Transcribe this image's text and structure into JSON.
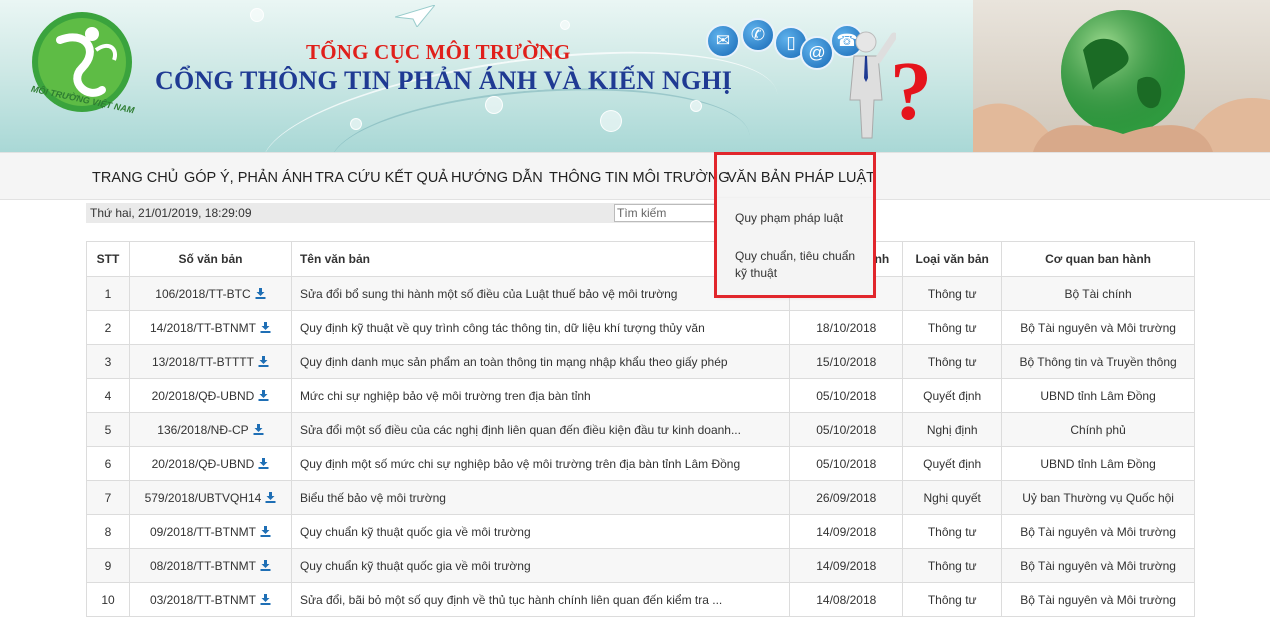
{
  "header": {
    "org_name": "TỔNG CỤC MÔI TRƯỜNG",
    "portal_name": "CỔNG THÔNG TIN PHẢN ÁNH VÀ KIẾN NGHỊ",
    "logo_text": "MÔI TRƯỜNG VIỆT NAM"
  },
  "nav": {
    "items": [
      {
        "label": "TRANG CHỦ"
      },
      {
        "label": "GÓP Ý, PHẢN ÁNH"
      },
      {
        "label": "TRA CỨU KẾT QUẢ"
      },
      {
        "label": "HƯỚNG DẪN"
      },
      {
        "label": "THÔNG TIN MÔI TRƯỜNG"
      },
      {
        "label": "VĂN BẢN PHÁP LUẬT"
      }
    ],
    "dropdown": [
      {
        "label": "Quy phạm pháp luật"
      },
      {
        "label": "Quy chuẩn, tiêu chuẩn kỹ thuật"
      }
    ]
  },
  "datebar": {
    "date_text": "Thứ hai, 21/01/2019, 18:29:09",
    "search_placeholder": "Tìm kiếm"
  },
  "table": {
    "headers": {
      "stt": "STT",
      "so_van_ban": "Số văn bản",
      "ten_van_ban": "Tên văn bản",
      "ngay": "Ngày ban hành",
      "loai": "Loại văn bản",
      "co_quan": "Cơ quan ban hành"
    },
    "rows": [
      {
        "stt": "1",
        "so": "106/2018/TT-BTC",
        "ten": "Sửa đổi bổ sung thi hành một số điều của Luật thuế bảo vệ môi trường",
        "ngay": "",
        "loai": "Thông tư",
        "coquan": "Bộ Tài chính"
      },
      {
        "stt": "2",
        "so": "14/2018/TT-BTNMT",
        "ten": "Quy định kỹ thuật về quy trình công tác thông tin, dữ liệu khí tượng thủy văn",
        "ngay": "18/10/2018",
        "loai": "Thông tư",
        "coquan": "Bộ Tài nguyên và Môi trường"
      },
      {
        "stt": "3",
        "so": "13/2018/TT-BTTTT",
        "ten": "Quy định danh mục sản phẩm an toàn thông tin mạng nhập khẩu theo giấy phép",
        "ngay": "15/10/2018",
        "loai": "Thông tư",
        "coquan": "Bộ Thông tin và Truyền thông"
      },
      {
        "stt": "4",
        "so": "20/2018/QĐ-UBND",
        "ten": "Mức chi sự nghiệp bảo vệ môi trường tren địa bàn tỉnh",
        "ngay": "05/10/2018",
        "loai": "Quyết định",
        "coquan": "UBND tỉnh Lâm Đồng"
      },
      {
        "stt": "5",
        "so": "136/2018/NĐ-CP",
        "ten": "Sửa đổi một số điều của các nghị định liên quan đến điều kiện đầu tư kinh doanh...",
        "ngay": "05/10/2018",
        "loai": "Nghị định",
        "coquan": "Chính phủ"
      },
      {
        "stt": "6",
        "so": "20/2018/QĐ-UBND",
        "ten": "Quy định một số mức chi sự nghiệp bảo vệ môi trường trên địa bàn tỉnh Lâm Đồng",
        "ngay": "05/10/2018",
        "loai": "Quyết định",
        "coquan": "UBND tỉnh Lâm Đồng"
      },
      {
        "stt": "7",
        "so": "579/2018/UBTVQH14",
        "ten": "Biểu thế bảo vệ môi trường",
        "ngay": "26/09/2018",
        "loai": "Nghị quyết",
        "coquan": "Uỷ ban Thường vụ Quốc hội"
      },
      {
        "stt": "8",
        "so": "09/2018/TT-BTNMT",
        "ten": "Quy chuẩn kỹ thuật quốc gia về môi trường",
        "ngay": "14/09/2018",
        "loai": "Thông tư",
        "coquan": "Bộ Tài nguyên và Môi trường"
      },
      {
        "stt": "9",
        "so": "08/2018/TT-BTNMT",
        "ten": "Quy chuẩn kỹ thuật quốc gia về môi trường",
        "ngay": "14/09/2018",
        "loai": "Thông tư",
        "coquan": "Bộ Tài nguyên và Môi trường"
      },
      {
        "stt": "10",
        "so": "03/2018/TT-BTNMT",
        "ten": "Sửa đổi, bãi bỏ một số quy định về thủ tục hành chính liên quan đến kiểm tra ...",
        "ngay": "14/08/2018",
        "loai": "Thông tư",
        "coquan": "Bộ Tài nguyên và Môi trường"
      }
    ]
  },
  "colors": {
    "title_red": "#e0201b",
    "title_blue": "#1f3a93",
    "download_blue": "#1f6fb5",
    "highlight_red": "#e1262c"
  }
}
